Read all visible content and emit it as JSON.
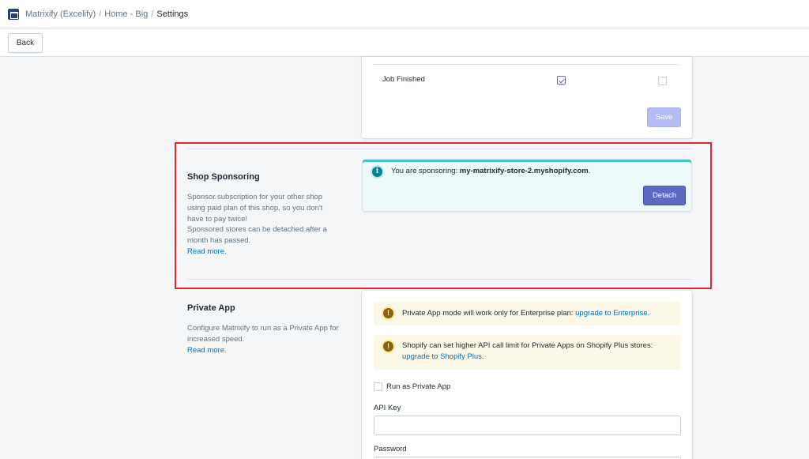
{
  "breadcrumb": {
    "app": "Matrixify (Excelify)",
    "sep": "/",
    "home": "Home - Big",
    "current": "Settings"
  },
  "action_bar": {
    "back_label": "Back"
  },
  "notifications": {
    "job_finished_label": "Job Finished",
    "job_finished_email_checked": true,
    "job_finished_other_checked": false,
    "save_label": "Save"
  },
  "shop_sponsoring": {
    "title": "Shop Sponsoring",
    "description": "Sponsor subscription for your other shop using paid plan of this shop, so you don't have to pay twice!",
    "description2": "Sponsored stores can be detached after a month has passed.",
    "read_more": "Read more.",
    "banner_prefix": "You are sponsoring: ",
    "banner_store": "my-matrixify-store-2.myshopify.com",
    "banner_suffix": ".",
    "detach_label": "Detach",
    "info_icon": "info-icon"
  },
  "private_app": {
    "title": "Private App",
    "description": "Configure Matrixify to run as a Private App for increased speed.",
    "read_more": "Read more.",
    "warning1_text": "Private App mode will work only for Enterprise plan: ",
    "warning1_link": "upgrade to Enterprise",
    "warning1_suffix": ".",
    "warning2_text": "Shopify can set higher API call limit for Private Apps on Shopify Plus stores: ",
    "warning2_link": "upgrade to Shopify Plus",
    "warning2_suffix": ".",
    "run_as_private_label": "Run as Private App",
    "run_as_private_checked": false,
    "api_key_label": "API Key",
    "api_key_value": "",
    "password_label": "Password",
    "warning_icon": "exclamation-icon"
  },
  "colors": {
    "accent": "#5c6ac4",
    "link": "#006fbb",
    "highlight": "#e3262e",
    "info_bg": "#eef9f9",
    "warn_bg": "#fcf8e8"
  }
}
